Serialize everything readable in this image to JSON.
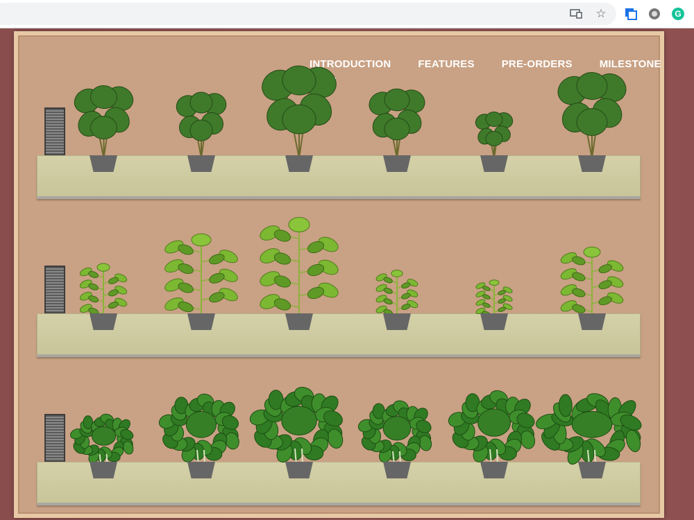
{
  "browser": {
    "icons": [
      "cast-icon",
      "bookmark-star-icon",
      "extension-icon",
      "extension-icon",
      "grammarly-icon"
    ],
    "grammarly_letter": "G"
  },
  "nav": {
    "items": [
      {
        "label": "INTRODUCTION",
        "active": true
      },
      {
        "label": "FEATURES",
        "active": false
      },
      {
        "label": "PRE-ORDERS",
        "active": false
      },
      {
        "label": "MILESTONE",
        "active": false
      }
    ]
  },
  "colors": {
    "page_bg": "#8e4f4f",
    "wall": "#c9a184",
    "frame": "#e7c9a5",
    "shelf": "#cfcba0",
    "pot": "#666666",
    "nav_text": "#ffffff"
  },
  "shelves": [
    {
      "plant_type": "large-leaf",
      "plants": 6
    },
    {
      "plant_type": "tomato-seedling",
      "plants": 6
    },
    {
      "plant_type": "bushy-herb",
      "plants": 6
    }
  ]
}
